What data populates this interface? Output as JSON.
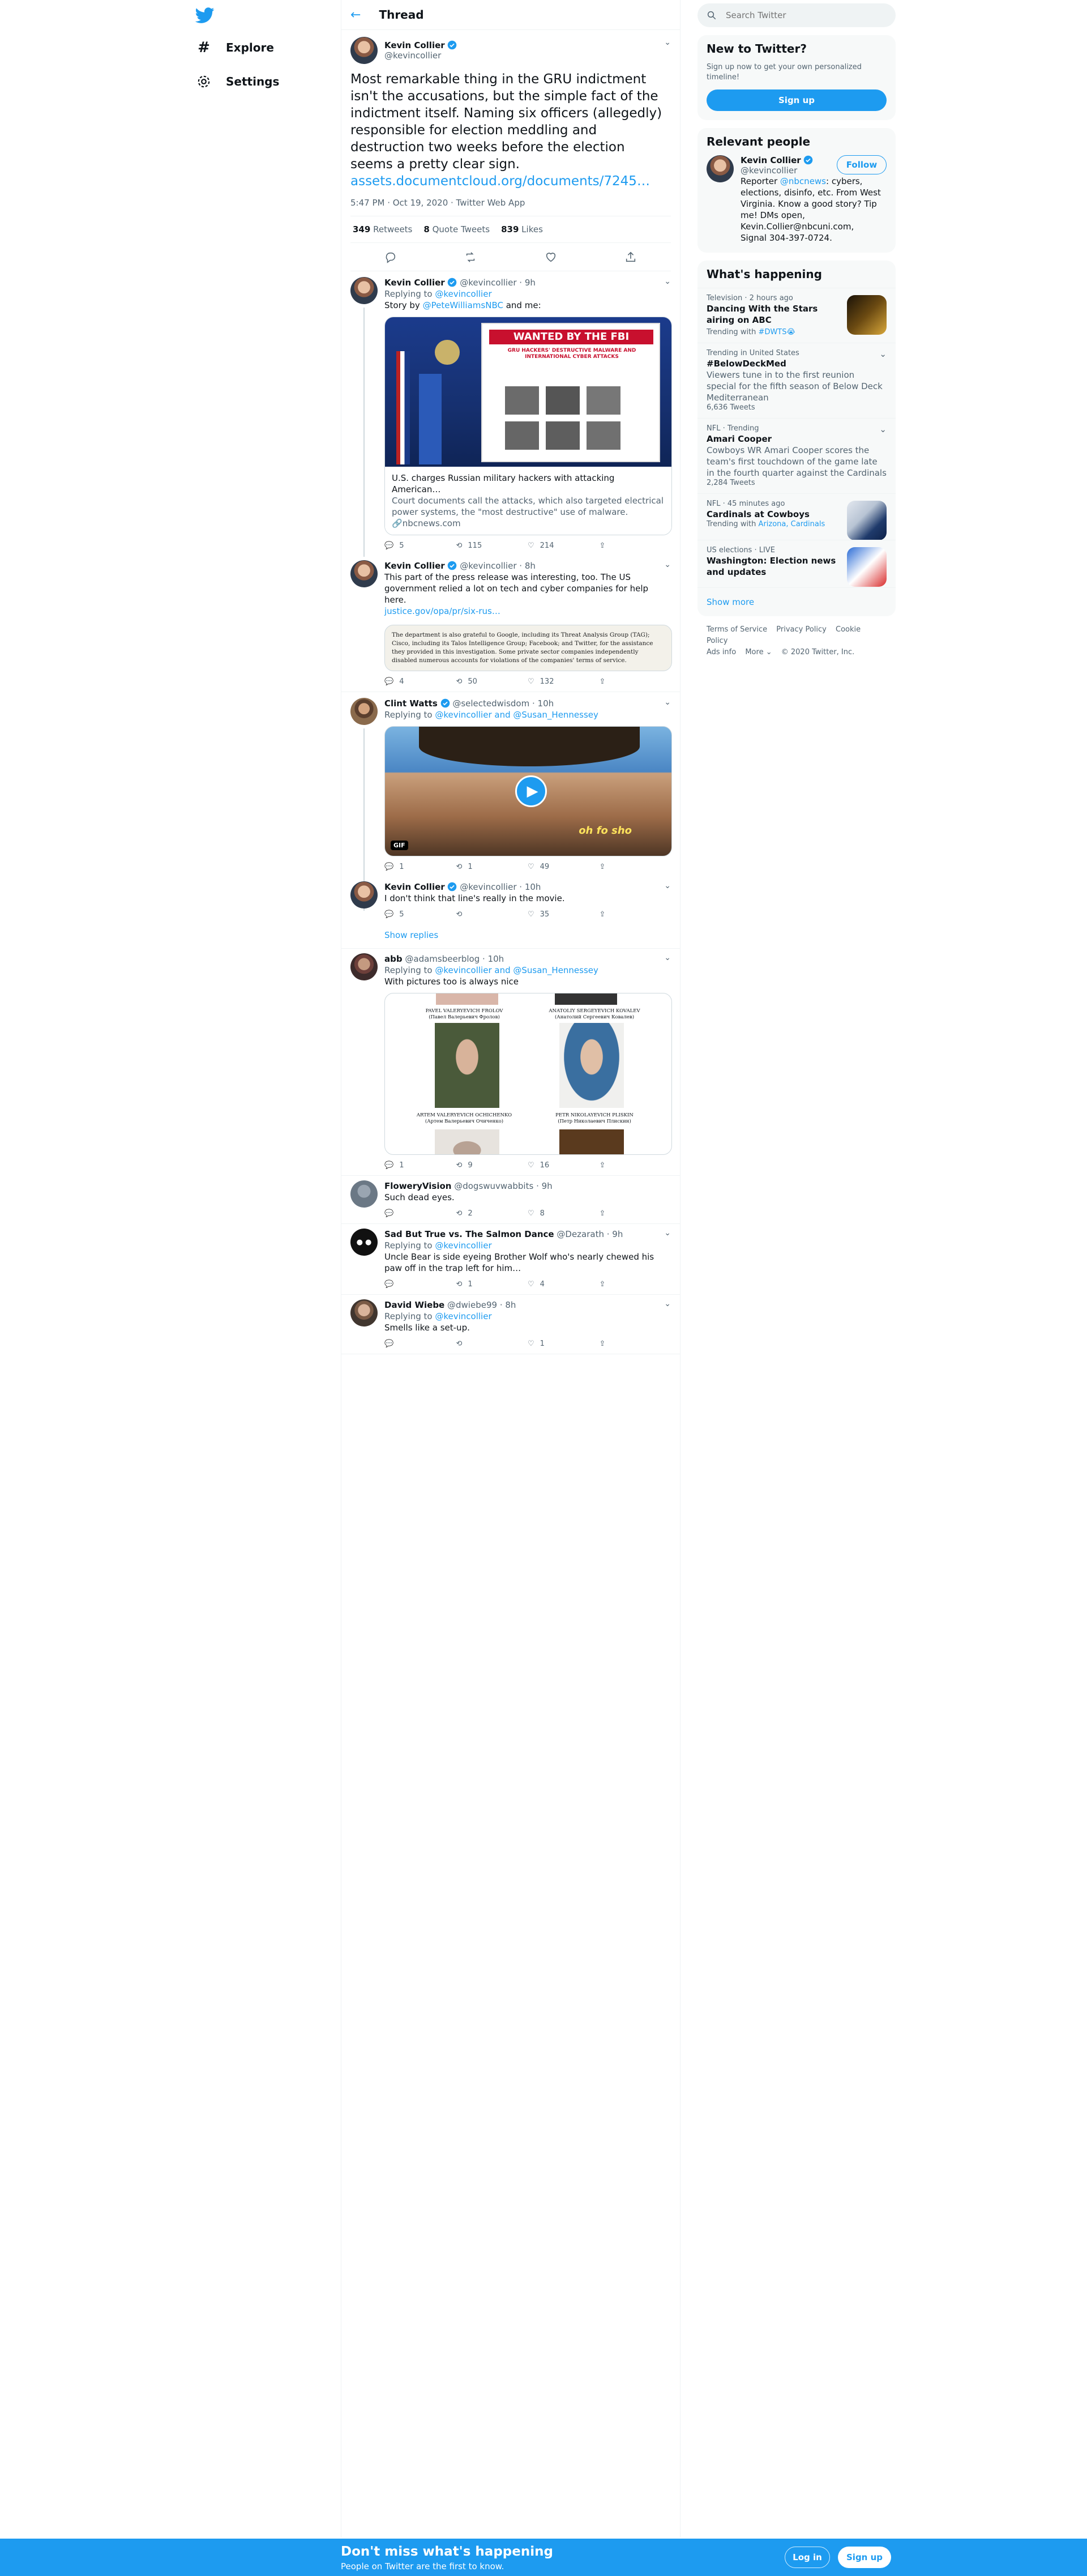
{
  "nav": {
    "explore": "Explore",
    "settings": "Settings"
  },
  "header": {
    "title": "Thread"
  },
  "main_tweet": {
    "name": "Kevin Collier",
    "handle": "@kevincollier",
    "text": "Most remarkable thing in the GRU indictment isn't the accusations, but the simple fact of the indictment itself. Naming six officers (allegedly) responsible for election meddling and destruction two weeks before the election seems a pretty clear sign.",
    "link": "assets.documentcloud.org/documents/7245…",
    "meta": "5:47 PM · Oct 19, 2020 · Twitter Web App",
    "retweets_count": "349",
    "retweets_label": "Retweets",
    "quotes_count": "8",
    "quotes_label": "Quote Tweets",
    "likes_count": "839",
    "likes_label": "Likes"
  },
  "replies": [
    {
      "name": "Kevin Collier",
      "handle": "@kevincollier",
      "time": "· 9h",
      "replying_prefix": "Replying to",
      "replying_to": "@kevincollier",
      "text_prefix": "Story by",
      "text_mention": "@PeteWilliamsNBC",
      "text_suffix": "and me:",
      "card_poster_title": "WANTED BY THE FBI",
      "card_poster_sub": "GRU HACKERS' DESTRUCTIVE MALWARE AND INTERNATIONAL CYBER ATTACKS",
      "card_title": "U.S. charges Russian military hackers with attacking American…",
      "card_desc": "Court documents call the attacks, which also targeted electrical power systems, the \"most destructive\" use of malware.",
      "card_domain": "nbcnews.com",
      "replies": "5",
      "retweets": "115",
      "likes": "214"
    },
    {
      "name": "Kevin Collier",
      "handle": "@kevincollier",
      "time": "· 8h",
      "text": "This part of the press release was interesting, too. The US government relied a lot on tech and cyber companies for help here.",
      "link": "justice.gov/opa/pr/six-rus…",
      "quote": "The department is also grateful to Google, including its Threat Analysis Group (TAG); Cisco, including its Talos Intelligence Group; Facebook; and Twitter, for the assistance they provided in this investigation. Some private sector companies independently disabled numerous accounts for violations of the companies' terms of service.",
      "replies": "4",
      "retweets": "50",
      "likes": "132"
    },
    {
      "name": "Clint Watts",
      "handle": "@selectedwisdom",
      "time": "· 10h",
      "replying_prefix": "Replying to",
      "replying_to": "@kevincollier and @Susan_Hennessey",
      "gif_badge": "GIF",
      "gif_caption": "oh fo sho",
      "replies": "1",
      "retweets": "1",
      "likes": "49"
    },
    {
      "name": "Kevin Collier",
      "handle": "@kevincollier",
      "time": "· 10h",
      "text": "I don't think that line's really in the movie.",
      "replies": "5",
      "retweets": "",
      "likes": "35"
    },
    {
      "name": "abb",
      "handle": "@adamsbeerblog",
      "time": "· 10h",
      "replying_prefix": "Replying to",
      "replying_to": "@kevincollier and @Susan_Hennessey",
      "text": "With pictures too is always nice",
      "cap1": "PAVEL VALERYEVICH FROLOV",
      "cap1b": "(Павел Валерьевич Фролов)",
      "cap2": "ANATOLIY SERGEYEVICH KOVALEV",
      "cap2b": "(Анатолий Сергеевич Ковалев)",
      "cap3": "ARTEM VALERYEVICH OCHICHENKO",
      "cap3b": "(Артем Валерьевич Очиченко)",
      "cap4": "PETR NIKOLAYEVICH PLISKIN",
      "cap4b": "(Петр Николаевич Плискин)",
      "replies": "1",
      "retweets": "9",
      "likes": "16"
    },
    {
      "name": "FloweryVision",
      "handle": "@dogswuvwabbits",
      "time": "· 9h",
      "text": "Such dead eyes.",
      "replies": "",
      "retweets": "2",
      "likes": "8"
    },
    {
      "name": "Sad But True vs. The Salmon Dance",
      "handle": "@Dezarath",
      "time": "· 9h",
      "replying_prefix": "Replying to",
      "replying_to": "@kevincollier",
      "text": "Uncle Bear is side eyeing  Brother Wolf who's nearly chewed his paw off in the trap left for him…",
      "replies": "",
      "retweets": "1",
      "likes": "4"
    },
    {
      "name": "David Wiebe",
      "handle": "@dwiebe99",
      "time": "· 8h",
      "replying_prefix": "Replying to",
      "replying_to": "@kevincollier",
      "text": "Smells like a set-up.",
      "replies": "",
      "retweets": "",
      "likes": "1"
    }
  ],
  "show_replies": "Show replies",
  "search": {
    "placeholder": "Search Twitter"
  },
  "new_to_twitter": {
    "title": "New to Twitter?",
    "sub": "Sign up now to get your own personalized timeline!",
    "signup": "Sign up"
  },
  "relevant": {
    "title": "Relevant people",
    "name": "Kevin Collier",
    "handle": "@kevincollier",
    "follow": "Follow",
    "bio_prefix": "Reporter",
    "bio_mention": "@nbcnews",
    "bio_rest": ": cybers, elections, disinfo, etc. From West Virginia. Know a good story? Tip me! DMs open, Kevin.Collier@nbcuni.com, Signal 304-397-0724."
  },
  "happening": {
    "title": "What's happening",
    "trends": [
      {
        "meta": "Television · 2 hours ago",
        "title": "Dancing With the Stars airing on ABC",
        "extra_prefix": "Trending with",
        "extra_link": "#DWTS😭"
      },
      {
        "meta": "Trending in United States",
        "title": "#BelowDeckMed",
        "desc": "Viewers tune in to the first reunion special for the fifth season of Below Deck Mediterranean",
        "extra": "6,636 Tweets"
      },
      {
        "meta": "NFL · Trending",
        "title": "Amari Cooper",
        "desc": "Cowboys WR Amari Cooper scores the team's first touchdown of the game late in the fourth quarter against the Cardinals",
        "extra": "2,284 Tweets"
      },
      {
        "meta": "NFL · 45 minutes ago",
        "title": "Cardinals at Cowboys",
        "extra_prefix": "Trending with",
        "extra_link": "Arizona, Cardinals"
      },
      {
        "meta": "US elections · LIVE",
        "title": "Washington: Election news and updates"
      }
    ],
    "show_more": "Show more"
  },
  "footer": {
    "terms": "Terms of Service",
    "privacy": "Privacy Policy",
    "cookie": "Cookie Policy",
    "ads": "Ads info",
    "more": "More ⌄",
    "copyright": "© 2020 Twitter, Inc."
  },
  "bottom": {
    "title": "Don't miss what's happening",
    "sub": "People on Twitter are the first to know.",
    "login": "Log in",
    "signup": "Sign up"
  },
  "colors": {
    "accent": "#1d9bf0",
    "text": "#0f1419",
    "muted": "#536471"
  }
}
